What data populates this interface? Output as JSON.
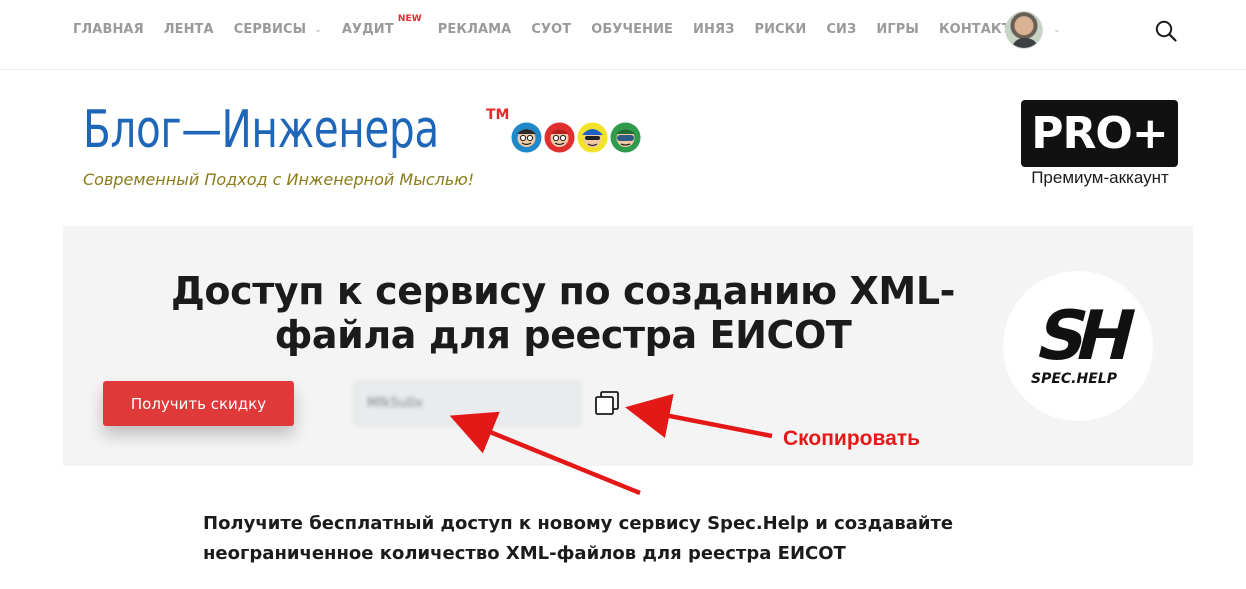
{
  "nav": {
    "items": [
      {
        "label": "ГЛАВНАЯ"
      },
      {
        "label": "ЛЕНТА"
      },
      {
        "label": "СЕРВИСЫ",
        "dropdown": true
      },
      {
        "label": "АУДИТ",
        "badge": "NEW"
      },
      {
        "label": "РЕКЛАМА"
      },
      {
        "label": "СУОТ"
      },
      {
        "label": "ОБУЧЕНИЕ"
      },
      {
        "label": "ИНЯЗ"
      },
      {
        "label": "РИСКИ"
      },
      {
        "label": "СИЗ"
      },
      {
        "label": "ИГРЫ"
      },
      {
        "label": "КОНТАКТЫ"
      }
    ],
    "icons": {
      "profile": "avatar-icon",
      "search": "search-icon"
    }
  },
  "logo": {
    "title": "Блог—Инженера",
    "trademark": "TM",
    "tagline": "Современный Подход с Инженерной Мыслью!",
    "faces": [
      "blue-face-icon",
      "red-face-icon",
      "yellow-face-icon",
      "green-face-icon"
    ]
  },
  "pro": {
    "label": "PRO+",
    "subtitle": "Премиум-аккаунт"
  },
  "panel": {
    "title": "Доступ к сервису по созданию XML-файла для реестра ЕИСОТ",
    "discount_button": "Получить скидку",
    "code_value": "Mfk5u0x",
    "copy_icon": "copy-icon",
    "service_logo": {
      "letters": "SH",
      "caption": "SPEC.HELP"
    }
  },
  "annotation": {
    "copy_label": "Скопировать"
  },
  "description": "Получите бесплатный доступ к новому сервису Spec.Help и создавайте неограниченное количество XML-файлов для реестра ЕИСОТ",
  "colors": {
    "accent_red": "#e0393a",
    "logo_blue": "#1e66b8",
    "tagline_olive": "#8a7d1a",
    "nav_gray": "#9a9a9a"
  }
}
